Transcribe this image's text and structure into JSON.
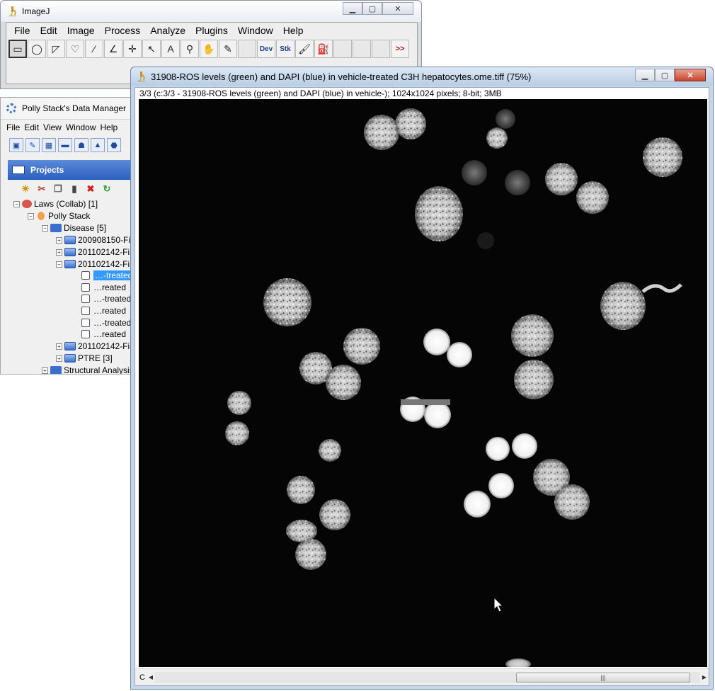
{
  "imagej": {
    "title": "ImageJ",
    "menu": [
      "File",
      "Edit",
      "Image",
      "Process",
      "Analyze",
      "Plugins",
      "Window",
      "Help"
    ],
    "tool_text": {
      "text": "A",
      "dev": "Dev",
      "stk": "Stk",
      "more": ">>"
    }
  },
  "data_manager": {
    "title": "Polly Stack's Data Manager",
    "menu": [
      "File",
      "Edit",
      "View",
      "Window",
      "Help"
    ],
    "panel_title": "Projects",
    "tree": [
      {
        "label": "Laws (Collab) [1]",
        "selected": false
      },
      {
        "label": "Polly Stack",
        "selected": false
      },
      {
        "label": "Disease [5]",
        "selected": false
      },
      {
        "label": "200908150-Fi",
        "selected": false
      },
      {
        "label": "201102142-Fi",
        "selected": false
      },
      {
        "label": "201102142-Fi",
        "selected": false
      },
      {
        "label": "…-treated",
        "selected": true
      },
      {
        "label": "…reated",
        "selected": false
      },
      {
        "label": "…-treated",
        "selected": false
      },
      {
        "label": "…reated",
        "selected": false
      },
      {
        "label": "…-treated",
        "selected": false
      },
      {
        "label": "…reated",
        "selected": false
      },
      {
        "label": "201102142-Fi",
        "selected": false
      },
      {
        "label": "PTRE [3]",
        "selected": false
      },
      {
        "label": "Structural Analysis",
        "selected": false
      }
    ]
  },
  "image_window": {
    "title": "31908-ROS levels (green) and DAPI (blue) in vehicle-treated C3H hepatocytes.ome.tiff (75%)",
    "info": "3/3 (c:3/3 - 31908-ROS levels (green) and DAPI (blue) in vehicle-); 1024x1024 pixels; 8-bit; 3MB",
    "channel_label": "C"
  }
}
